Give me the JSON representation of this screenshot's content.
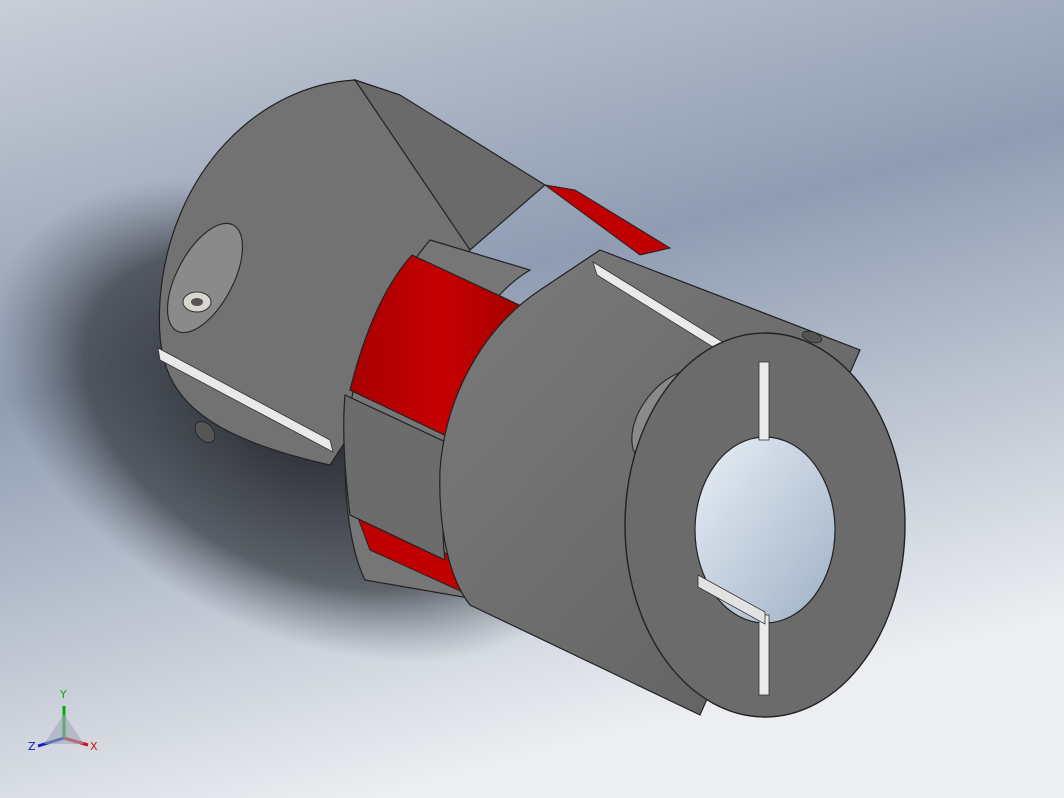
{
  "viewport": {
    "background_top": "#c7ccd6",
    "background_mid": "#8e9bb1",
    "background_bottom": "#e7e8ec"
  },
  "part": {
    "body_color": "#6d6d6d",
    "body_highlight": "#8a8a8a",
    "end_face_color": "#696969",
    "slot_color": "#f0f0f0",
    "spider_color": "#c10000",
    "spider_highlight": "#e00000",
    "bore_color": "#c8d2e0"
  },
  "triad": {
    "x_label": "X",
    "y_label": "Y",
    "z_label": "Z",
    "x_color": "#d01010",
    "y_color": "#10a010",
    "z_color": "#1020c0"
  }
}
